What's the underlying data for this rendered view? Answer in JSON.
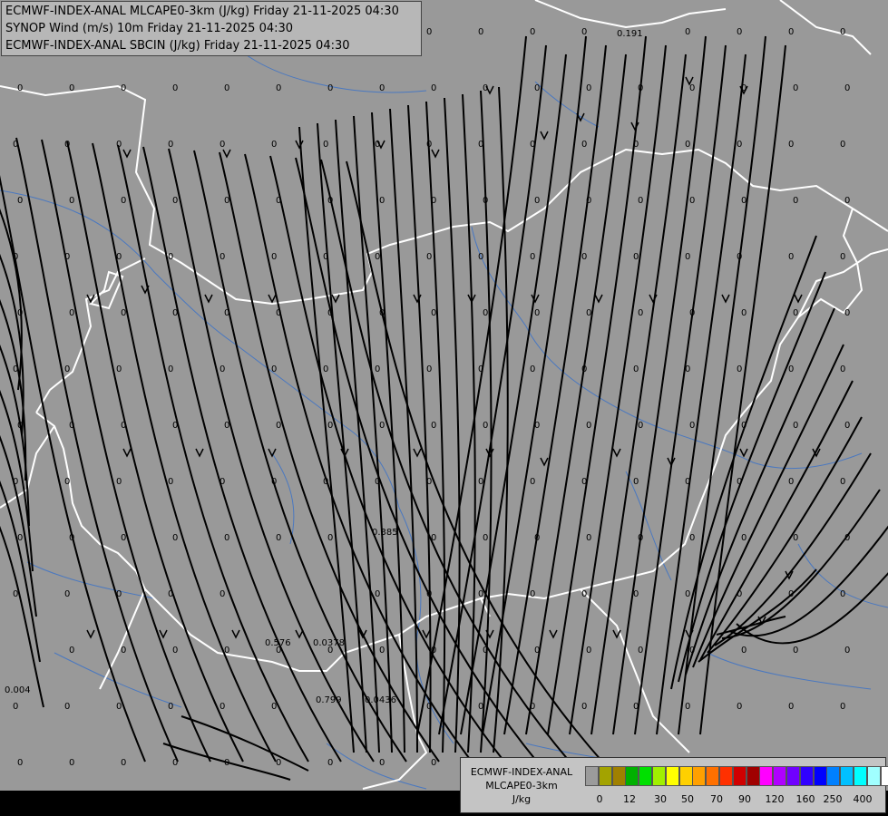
{
  "titles": {
    "line1": "ECMWF-INDEX-ANAL MLCAPE0-3km (J/kg) Friday 21-11-2025 04:30",
    "line2": "SYNOP Wind (m/s) 10m Friday 21-11-2025 04:30",
    "line3": "ECMWF-INDEX-ANAL SBCIN (J/kg) Friday 21-11-2025 04:30"
  },
  "legend": {
    "line1": "ECMWF-INDEX-ANAL",
    "line2": "MLCAPE0-3km",
    "unit": "J/kg",
    "colors": [
      "#9b9b9b",
      "#a3a300",
      "#a08000",
      "#00b000",
      "#00e000",
      "#a0f000",
      "#ffff00",
      "#ffd000",
      "#ffa000",
      "#ff7000",
      "#ff3000",
      "#d00000",
      "#a00000",
      "#ff00ff",
      "#b000ff",
      "#7000ff",
      "#3000ff",
      "#0000ff",
      "#0080ff",
      "#00c0ff",
      "#00ffff",
      "#a0ffff",
      "#ffffff"
    ],
    "ticks": [
      "0",
      "12",
      "30",
      "50",
      "70",
      "90",
      "120",
      "160",
      "250",
      "400"
    ]
  },
  "grid_values": {
    "row_labels": [
      "0",
      "0.191",
      "0.385",
      "0.576",
      "0.0378",
      "0.799",
      "0.0436",
      "0.004"
    ]
  }
}
